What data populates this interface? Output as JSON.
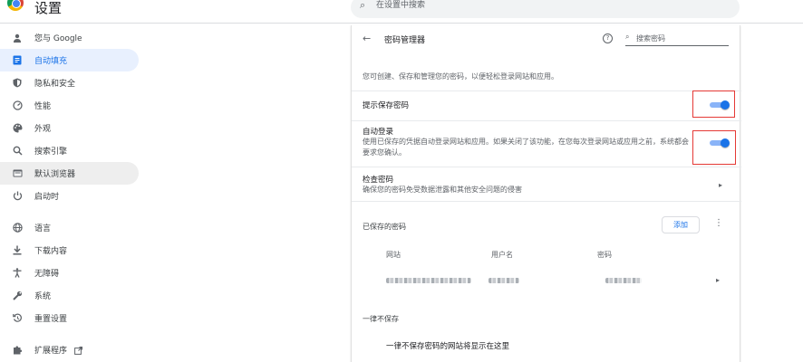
{
  "header": {
    "title": "设置",
    "search_placeholder": "在设置中搜索"
  },
  "sidebar": {
    "items": [
      {
        "label": "您与 Google",
        "icon": "person-icon",
        "state": "normal"
      },
      {
        "label": "自动填充",
        "icon": "autofill-icon",
        "state": "active"
      },
      {
        "label": "隐私和安全",
        "icon": "shield-icon",
        "state": "normal"
      },
      {
        "label": "性能",
        "icon": "speedometer-icon",
        "state": "normal"
      },
      {
        "label": "外观",
        "icon": "palette-icon",
        "state": "normal"
      },
      {
        "label": "搜索引擎",
        "icon": "search-icon",
        "state": "normal"
      },
      {
        "label": "默认浏览器",
        "icon": "browser-icon",
        "state": "hover"
      },
      {
        "label": "启动时",
        "icon": "power-icon",
        "state": "normal"
      },
      {
        "label": "语言",
        "icon": "globe-icon",
        "state": "normal"
      },
      {
        "label": "下载内容",
        "icon": "download-icon",
        "state": "normal"
      },
      {
        "label": "无障碍",
        "icon": "accessibility-icon",
        "state": "normal"
      },
      {
        "label": "系统",
        "icon": "wrench-icon",
        "state": "normal"
      },
      {
        "label": "重置设置",
        "icon": "reset-icon",
        "state": "normal"
      },
      {
        "label": "扩展程序",
        "icon": "puzzle-icon",
        "state": "normal"
      }
    ]
  },
  "main": {
    "title": "密码管理器",
    "search_placeholder": "搜索密码",
    "description": "您可创建、保存和管理您的密码，以便轻松登录网站和应用。",
    "offer_to_save": {
      "label": "提示保存密码",
      "enabled": true
    },
    "auto_signin": {
      "label": "自动登录",
      "sub_line1": "使用已保存的凭据自动登录网站和应用。如果关闭了该功能，在您每次登录网站或应用之前，系统都会",
      "sub_line2": "要求您确认。",
      "enabled": true
    },
    "check_passwords": {
      "label": "检查密码",
      "sub": "确保您的密码免受数据泄露和其他安全问题的侵害"
    },
    "saved_passwords": {
      "label": "已保存的密码",
      "add_label": "添加",
      "columns": [
        "网站",
        "用户名",
        "密码"
      ]
    },
    "never_saved": {
      "label": "一律不保存",
      "empty_text": "一律不保存密码的网站将显示在这里"
    }
  },
  "colors": {
    "accent": "#1a73e8",
    "active_bg": "#e8f0fe",
    "highlight_box": "#e53935"
  }
}
